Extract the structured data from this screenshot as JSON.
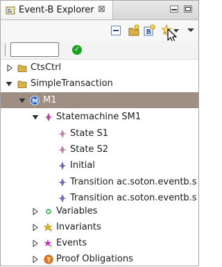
{
  "view": {
    "tab_title": "Event-B Explorer",
    "close_symbol": "⊠"
  },
  "toolbar": {
    "icons": [
      "collapse-all-icon",
      "new-project-icon",
      "new-component-icon",
      "new-wizard-icon",
      "view-menu-icon"
    ]
  },
  "filter": {
    "value": "",
    "placeholder": ""
  },
  "tree": [
    {
      "label": "CtsCtrl",
      "icon": "folder-icon",
      "expanded": false
    },
    {
      "label": "SimpleTransaction",
      "icon": "folder-icon",
      "expanded": true
    },
    {
      "label": "M1",
      "icon": "machine-icon",
      "expanded": true,
      "selected": true
    },
    {
      "label": "Statemachine SM1",
      "icon": "statemachine-icon",
      "expanded": true
    },
    {
      "label": "State S1",
      "icon": "state-icon"
    },
    {
      "label": "State S2",
      "icon": "state-icon"
    },
    {
      "label": "Initial",
      "icon": "initial-icon"
    },
    {
      "label": "Transition ac.soton.eventb.s",
      "icon": "transition-icon"
    },
    {
      "label": "Transition ac.soton.eventb.s",
      "icon": "transition-icon"
    },
    {
      "label": "Variables",
      "icon": "variables-icon",
      "expanded": false
    },
    {
      "label": "Invariants",
      "icon": "invariants-icon",
      "expanded": false
    },
    {
      "label": "Events",
      "icon": "events-icon",
      "expanded": false
    },
    {
      "label": "Proof Obligations",
      "icon": "proof-obligations-icon",
      "expanded": false
    }
  ],
  "colors": {
    "selection": "#9e8e84",
    "folder": "#c9a24a",
    "machine": "#2a62c8",
    "statemachine_diamond": "#b24fa0",
    "state_diamond": "#c07aa8",
    "initial_diamond": "#7a5fb8",
    "variables": "#2aa84a",
    "invariants": "#e0b91a",
    "events": "#c23ab7",
    "proof": "#e07a1f"
  }
}
